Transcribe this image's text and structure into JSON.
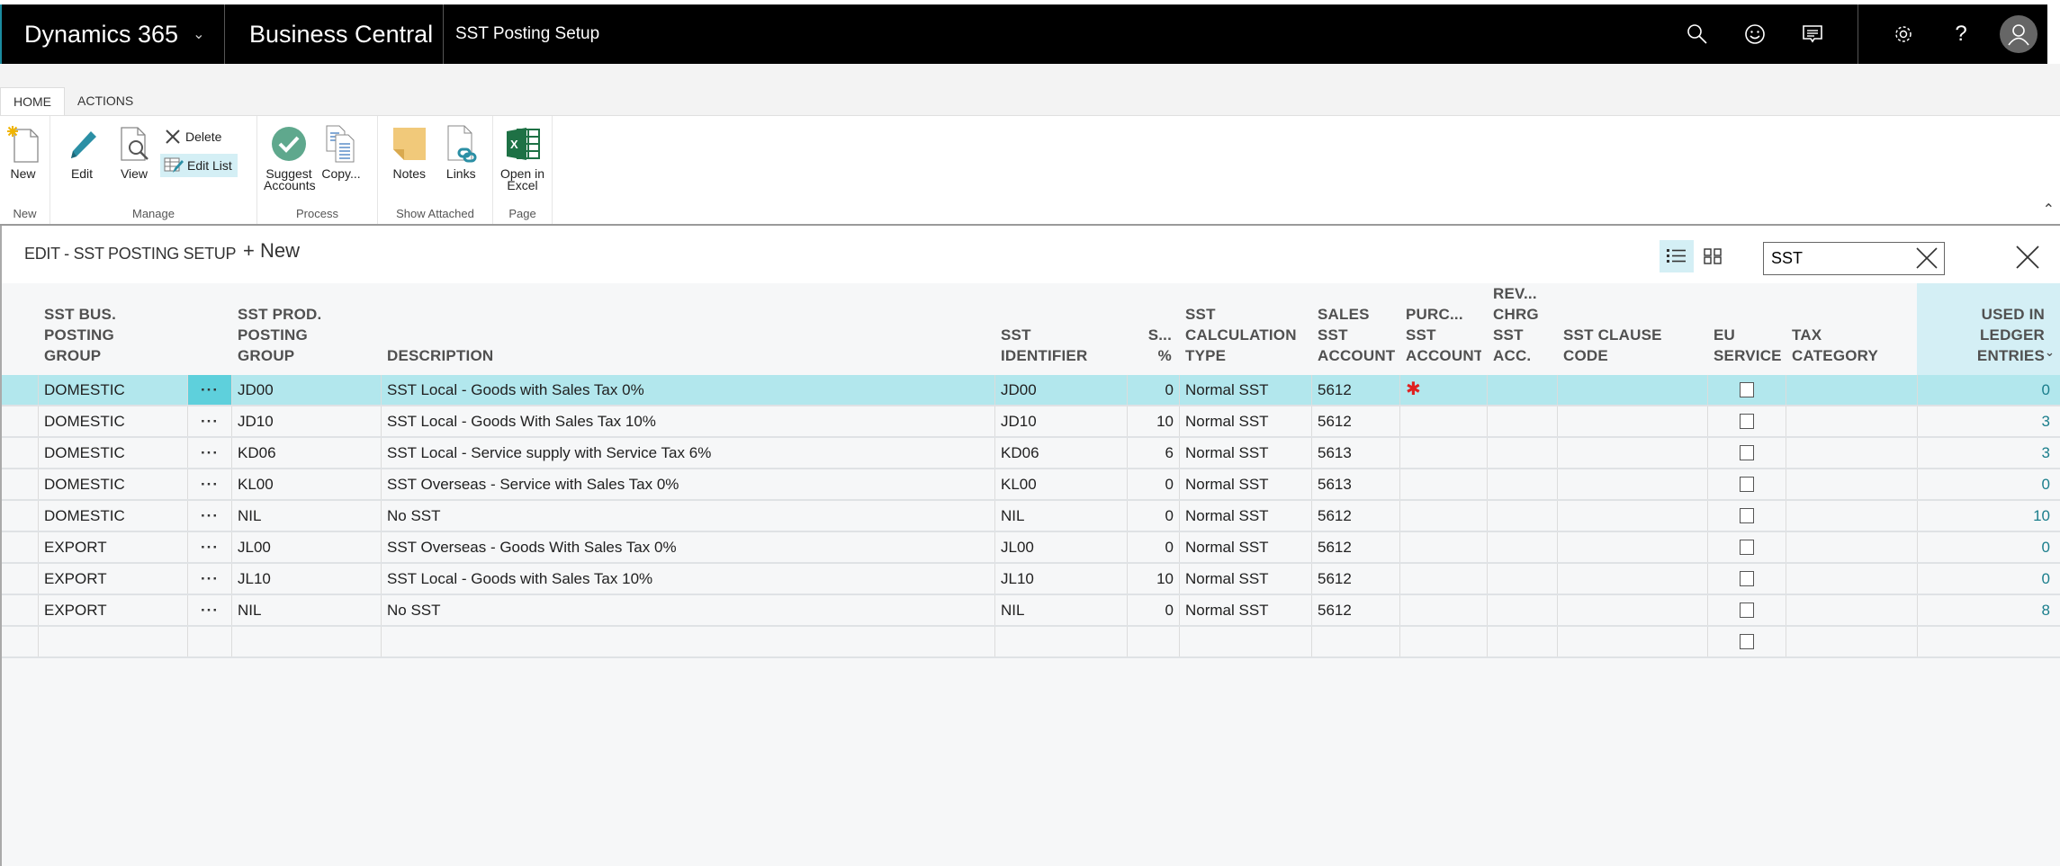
{
  "topbar": {
    "product": "Dynamics 365",
    "app": "Business Central",
    "page": "SST Posting Setup",
    "icons": [
      "search-icon",
      "smiley-icon",
      "chat-icon",
      "gear-icon",
      "help-icon",
      "user-avatar-icon"
    ]
  },
  "ribbon": {
    "tabs": [
      "HOME",
      "ACTIONS"
    ],
    "active_tab": "HOME",
    "groups": {
      "new": {
        "label": "New",
        "new": "New"
      },
      "manage": {
        "label": "Manage",
        "edit": "Edit",
        "view": "View",
        "delete": "Delete",
        "edit_list": "Edit List"
      },
      "process": {
        "label": "Process",
        "suggest": "Suggest Accounts",
        "copy": "Copy..."
      },
      "show_attached": {
        "label": "Show Attached",
        "notes": "Notes",
        "links": "Links"
      },
      "page": {
        "label": "Page",
        "excel": "Open in Excel"
      }
    }
  },
  "page": {
    "title": "EDIT - SST POSTING SETUP",
    "new_label": "New",
    "search_value": "SST"
  },
  "colors": {
    "selected_row": "#b2e7ed",
    "accent": "#1a7e8c",
    "required": "#e02020"
  },
  "columns": [
    "SST BUS.\nPOSTING\nGROUP",
    "SST PROD.\nPOSTING\nGROUP",
    "DESCRIPTION",
    "SST\nIDENTIFIER",
    "S...\n%",
    "SST\nCALCULATION\nTYPE",
    "SALES\nSST\nACCOUNT",
    "PURC...\nSST\nACCOUNT",
    "REV...\nCHRG\nSST\nACC.",
    "SST CLAUSE\nCODE",
    "EU\nSERVICE",
    "TAX\nCATEGORY",
    "USED IN\nLEDGER\nENTRIES"
  ],
  "rows": [
    {
      "bus": "DOMESTIC",
      "prod": "JD00",
      "desc": "SST Local - Goods with Sales Tax 0%",
      "ident": "JD00",
      "pct": "0",
      "calc": "Normal SST",
      "sales": "5612",
      "purch": "*",
      "rev": "",
      "clause": "",
      "eu": false,
      "tax": "",
      "used": "0"
    },
    {
      "bus": "DOMESTIC",
      "prod": "JD10",
      "desc": "SST Local - Goods With Sales Tax 10%",
      "ident": "JD10",
      "pct": "10",
      "calc": "Normal SST",
      "sales": "5612",
      "purch": "",
      "rev": "",
      "clause": "",
      "eu": false,
      "tax": "",
      "used": "3"
    },
    {
      "bus": "DOMESTIC",
      "prod": "KD06",
      "desc": "SST Local - Service supply with Service Tax 6%",
      "ident": "KD06",
      "pct": "6",
      "calc": "Normal SST",
      "sales": "5613",
      "purch": "",
      "rev": "",
      "clause": "",
      "eu": false,
      "tax": "",
      "used": "3"
    },
    {
      "bus": "DOMESTIC",
      "prod": "KL00",
      "desc": "SST Overseas - Service with Sales Tax 0%",
      "ident": "KL00",
      "pct": "0",
      "calc": "Normal SST",
      "sales": "5613",
      "purch": "",
      "rev": "",
      "clause": "",
      "eu": false,
      "tax": "",
      "used": "0"
    },
    {
      "bus": "DOMESTIC",
      "prod": "NIL",
      "desc": "No SST",
      "ident": "NIL",
      "pct": "0",
      "calc": "Normal SST",
      "sales": "5612",
      "purch": "",
      "rev": "",
      "clause": "",
      "eu": false,
      "tax": "",
      "used": "10"
    },
    {
      "bus": "EXPORT",
      "prod": "JL00",
      "desc": "SST Overseas - Goods With Sales Tax 0%",
      "ident": "JL00",
      "pct": "0",
      "calc": "Normal SST",
      "sales": "5612",
      "purch": "",
      "rev": "",
      "clause": "",
      "eu": false,
      "tax": "",
      "used": "0"
    },
    {
      "bus": "EXPORT",
      "prod": "JL10",
      "desc": "SST Local - Goods with Sales Tax 10%",
      "ident": "JL10",
      "pct": "10",
      "calc": "Normal SST",
      "sales": "5612",
      "purch": "",
      "rev": "",
      "clause": "",
      "eu": false,
      "tax": "",
      "used": "0"
    },
    {
      "bus": "EXPORT",
      "prod": "NIL",
      "desc": "No SST",
      "ident": "NIL",
      "pct": "0",
      "calc": "Normal SST",
      "sales": "5612",
      "purch": "",
      "rev": "",
      "clause": "",
      "eu": false,
      "tax": "",
      "used": "8"
    },
    {
      "bus": "",
      "prod": "",
      "desc": "",
      "ident": "",
      "pct": "",
      "calc": "",
      "sales": "",
      "purch": "",
      "rev": "",
      "clause": "",
      "eu": false,
      "tax": "",
      "used": "",
      "empty": true
    }
  ],
  "selected_row": 0
}
